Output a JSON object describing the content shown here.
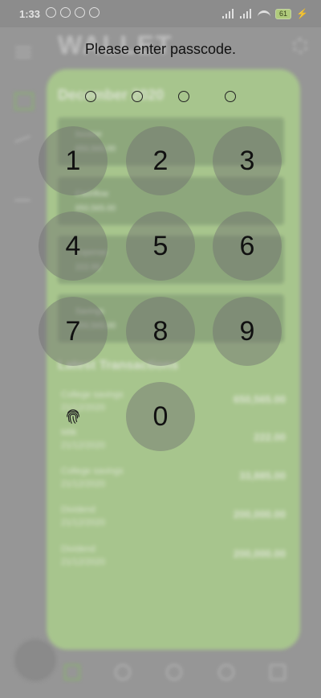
{
  "status_bar": {
    "time": "1:33",
    "battery": "61"
  },
  "app": {
    "title": "WALLET",
    "month": "December 2020",
    "summary": [
      {
        "label": "Income",
        "value": "650,565.00"
      },
      {
        "label": "Cashflow",
        "value": "650,565.00"
      },
      {
        "label": "Expense",
        "value": "222.00"
      },
      {
        "label": "Savings",
        "value": "650,565.00"
      }
    ],
    "latest_title": "Latest Transactions",
    "transactions": [
      {
        "name": "College savings",
        "date": "21/12/2020",
        "amount": "650,565.00"
      },
      {
        "name": "Milk",
        "date": "21/12/2020",
        "amount": "222.00"
      },
      {
        "name": "College savings",
        "date": "21/12/2020",
        "amount": "33,885.00"
      },
      {
        "name": "Dividend",
        "date": "21/12/2020",
        "amount": "200,000.00"
      },
      {
        "name": "Dividend",
        "date": "21/12/2020",
        "amount": "200,000.00"
      }
    ]
  },
  "passcode": {
    "prompt": "Please enter passcode.",
    "keys": [
      "1",
      "2",
      "3",
      "4",
      "5",
      "6",
      "7",
      "8",
      "9",
      "0"
    ],
    "entered": 0
  }
}
